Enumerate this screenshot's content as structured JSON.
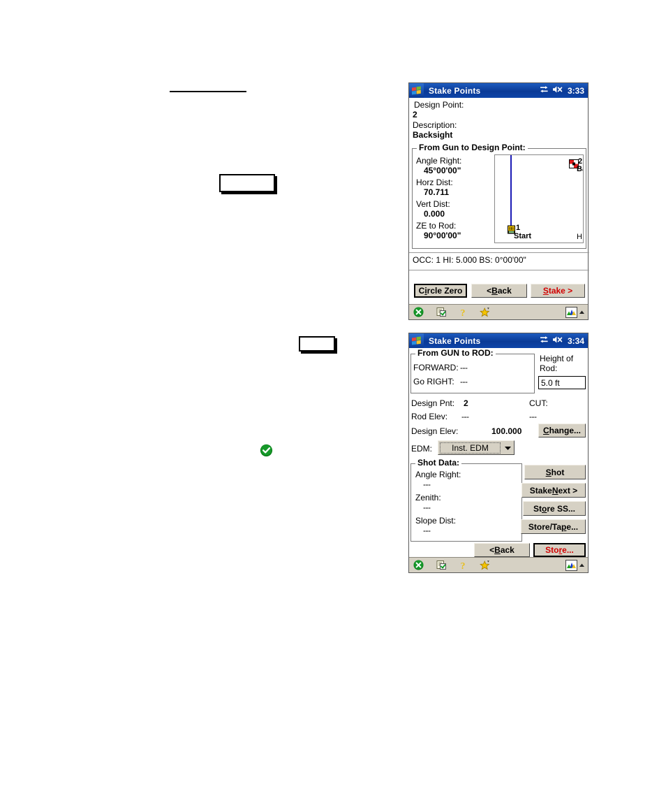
{
  "page": {
    "rule": "horizontal-rule",
    "callouts": [
      "",
      ""
    ],
    "check_badge_icon": "green-check-badge-icon"
  },
  "screen1": {
    "titlebar": {
      "app_title": "Stake Points",
      "time": "3:33",
      "icons": [
        "windows-logo-icon",
        "connectivity-icon",
        "speaker-muted-icon"
      ]
    },
    "fields": {
      "design_point_label": "Design Point:",
      "design_point_value": "2",
      "description_label": "Description:",
      "description_value": "Backsight"
    },
    "group": {
      "title": "From Gun to Design Point:",
      "rows": [
        {
          "label": "Angle Right:",
          "value": "45°00'00\""
        },
        {
          "label": "Horz Dist:",
          "value": "70.711"
        },
        {
          "label": "Vert Dist:",
          "value": "0.000"
        },
        {
          "label": "ZE to Rod:",
          "value": "90°00'00\""
        }
      ]
    },
    "map": {
      "point1_number": "1",
      "point1_name": "Start",
      "point2_number": "2",
      "point2_name": "Ba",
      "corner_marker": "H"
    },
    "status": "OCC: 1  HI: 5.000  BS: 0°00'00\"",
    "buttons": [
      {
        "name": "circle-zero-button",
        "pre": "C",
        "accel": "i",
        "post": "rcle Zero",
        "style": "default"
      },
      {
        "name": "back-button",
        "pre": "< ",
        "accel": "B",
        "post": "ack",
        "style": "normal"
      },
      {
        "name": "stake-button",
        "pre": "",
        "accel": "S",
        "post": "take >",
        "style": "red"
      }
    ],
    "taskbar": {
      "icons": [
        "close-icon",
        "tasklist-icon",
        "help-icon",
        "favorites-star-icon",
        "input-panel-icon",
        "chevron-up-icon"
      ]
    }
  },
  "screen2": {
    "titlebar": {
      "app_title": "Stake Points",
      "time": "3:34",
      "icons": [
        "windows-logo-icon",
        "connectivity-icon",
        "speaker-muted-icon"
      ]
    },
    "gun_to_rod": {
      "title": "From GUN to ROD:",
      "rows": [
        {
          "label": "FORWARD:",
          "value": "---"
        },
        {
          "label": "Go RIGHT:",
          "value": "---"
        }
      ]
    },
    "height_of_rod": {
      "label_line1": "Height of",
      "label_line2": "Rod:",
      "value": "5.0 ft"
    },
    "info": {
      "design_pnt_label": "Design Pnt:",
      "design_pnt_value": "2",
      "cut_label": "CUT:",
      "cut_value": "---",
      "rod_elev_label": "Rod Elev:",
      "rod_elev_value": "---",
      "design_elev_label": "Design Elev:",
      "design_elev_value": "100.000",
      "edm_label": "EDM:",
      "edm_selected": "Inst. EDM"
    },
    "shot_data": {
      "title": "Shot Data:",
      "rows": [
        {
          "label": "Angle Right:",
          "value": "---"
        },
        {
          "label": "Zenith:",
          "value": "---"
        },
        {
          "label": "Slope Dist:",
          "value": "---"
        }
      ]
    },
    "buttons": {
      "change": {
        "pre": "",
        "accel": "C",
        "post": "hange..."
      },
      "shot": {
        "pre": "",
        "accel": "S",
        "post": "hot"
      },
      "stake_next": {
        "pre": "Stake ",
        "accel": "N",
        "post": "ext >"
      },
      "store_ss": {
        "pre": "St",
        "accel": "o",
        "post": "re SS..."
      },
      "store_tape": {
        "pre": "Store/Ta",
        "accel": "p",
        "post": "e..."
      },
      "back": {
        "pre": "< ",
        "accel": "B",
        "post": "ack"
      },
      "store": {
        "pre": "Sto",
        "accel": "r",
        "post": "e..."
      }
    },
    "taskbar": {
      "icons": [
        "close-icon",
        "tasklist-icon",
        "help-icon",
        "favorites-star-icon",
        "input-panel-icon",
        "chevron-up-icon"
      ]
    }
  }
}
